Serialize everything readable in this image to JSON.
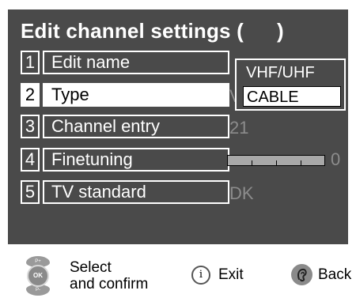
{
  "title": {
    "text": "Edit channel settings (",
    "close": ")"
  },
  "menu": {
    "items": [
      {
        "num": "1",
        "label": "Edit name"
      },
      {
        "num": "2",
        "label": "Type"
      },
      {
        "num": "3",
        "label": "Channel entry"
      },
      {
        "num": "4",
        "label": "Finetuning"
      },
      {
        "num": "5",
        "label": "TV standard"
      }
    ],
    "selected_index": 1
  },
  "values": {
    "type_partial": "V",
    "channel_entry": "21",
    "finetuning": "0",
    "tv_standard": "DK"
  },
  "finetuning_level": 0.5,
  "dropdown": {
    "options": [
      "VHF/UHF",
      "CABLE"
    ],
    "selected": "CABLE"
  },
  "footer": {
    "joystick": {
      "up": "P+",
      "ok": "OK",
      "down": "P-"
    },
    "select_line1": "Select",
    "select_line2": "and confirm",
    "info_glyph": "i",
    "exit": "Exit",
    "back": "Back"
  },
  "colors": {
    "panel": "#4a4a4a",
    "highlight": "#ffffff",
    "dim_value": "#8c8c8c"
  }
}
